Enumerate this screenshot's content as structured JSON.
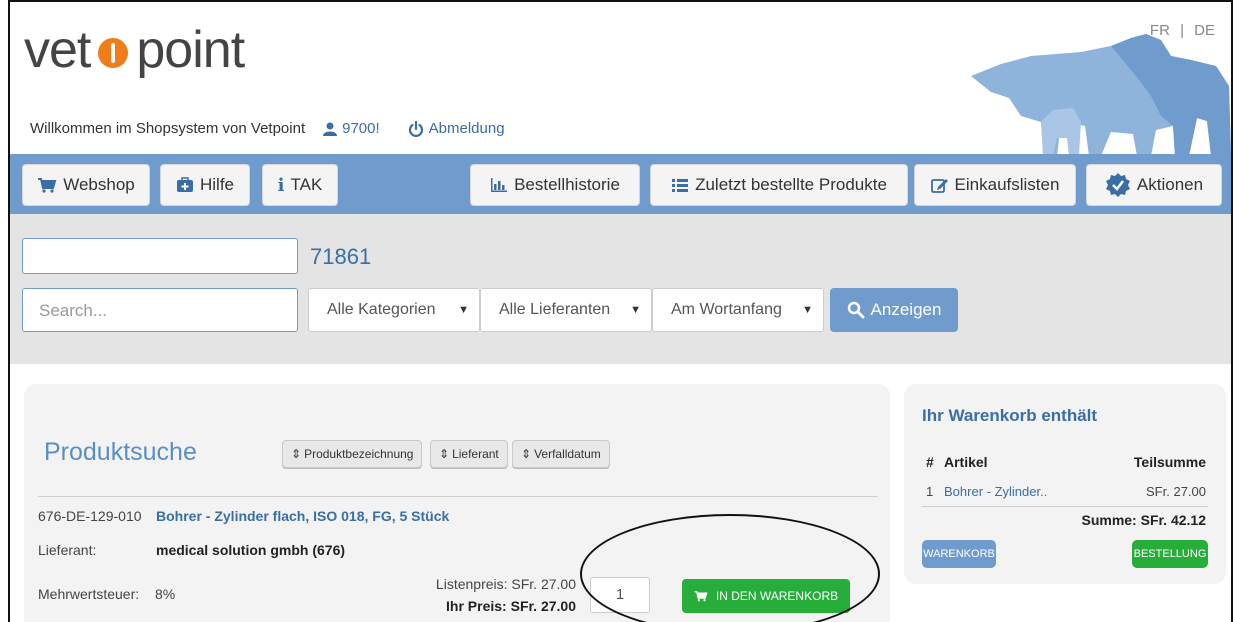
{
  "header": {
    "logo_left": "vet",
    "logo_right": "point",
    "lang_fr": "FR",
    "lang_sep": "|",
    "lang_de": "DE",
    "welcome": "Willkommen im Shopsystem von Vetpoint",
    "user": "9700!",
    "logout": "Abmeldung"
  },
  "nav": {
    "webshop": "Webshop",
    "hilfe": "Hilfe",
    "tak": "TAK",
    "history": "Bestellhistorie",
    "recent": "Zuletzt bestellte Produkte",
    "lists": "Einkaufslisten",
    "actions": "Aktionen"
  },
  "search": {
    "code": "71861",
    "placeholder": "Search...",
    "categories": "Alle Kategorien",
    "suppliers": "Alle Lieferanten",
    "mode": "Am Wortanfang",
    "show": "Anzeigen"
  },
  "products": {
    "title": "Produktsuche",
    "sort": [
      "Produktbezeichnung",
      "Lieferant",
      "Verfalldatum"
    ],
    "item": {
      "number": "676-DE-129-010",
      "name": "Bohrer - Zylinder flach, ISO 018, FG, 5 Stück",
      "supplier_label": "Lieferant:",
      "supplier": "medical solution gmbh (676)",
      "vat_label": "Mehrwertsteuer:",
      "vat": "8%",
      "list_price": "Listenpreis: SFr. 27.00",
      "your_price": "Ihr Preis: SFr. 27.00",
      "quantity": "1",
      "add_to_cart": "IN DEN WARENKORB"
    }
  },
  "cart": {
    "title": "Ihr Warenkorb enthält",
    "col_num": "#",
    "col_article": "Artikel",
    "col_subtotal": "Teilsumme",
    "row_num": "1",
    "row_article": "Bohrer - Zylinder..",
    "row_subtotal": "SFr. 27.00",
    "sum": "Summe: SFr. 42.12",
    "btn_cart": "WARENKORB",
    "btn_order": "BESTELLUNG"
  },
  "colors": {
    "brand_blue": "#6f9ccc",
    "link_blue": "#3a6ea5",
    "logo_orange": "#f07c1a",
    "cart_green": "#27ae3a"
  }
}
